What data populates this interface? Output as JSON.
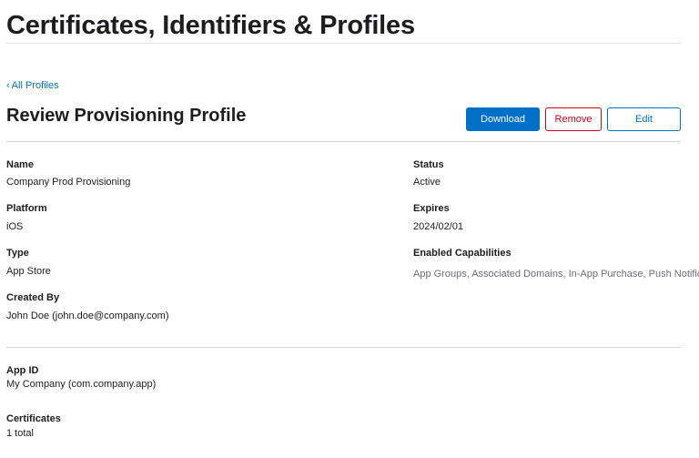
{
  "header": {
    "title": "Certificates, Identifiers & Profiles"
  },
  "nav": {
    "back_chevron": "‹",
    "back_label": "All Profiles"
  },
  "profile": {
    "heading": "Review Provisioning Profile",
    "actions": {
      "download": "Download",
      "remove": "Remove",
      "edit": "Edit"
    },
    "fields": {
      "name_label": "Name",
      "name_value": "Company Prod Provisioning",
      "platform_label": "Platform",
      "platform_value": "iOS",
      "type_label": "Type",
      "type_value": "App Store",
      "created_by_label": "Created By",
      "created_by_value": "John Doe (john.doe@company.com)",
      "status_label": "Status",
      "status_value": "Active",
      "expires_label": "Expires",
      "expires_value": "2024/02/01",
      "capabilities_label": "Enabled Capabilities",
      "capabilities_value": "App Groups, Associated Domains, In-App Purchase, Push Notifications"
    },
    "details": {
      "app_id_label": "App ID",
      "app_id_value": "My Company (com.company.app)",
      "certificates_label": "Certificates",
      "certificates_value": "1 total"
    }
  },
  "colors": {
    "accent": "#0070c9",
    "danger": "#d0021b",
    "text": "#1d1d1f",
    "muted_text": "#6e6e73",
    "divider": "#d9d9d9"
  }
}
